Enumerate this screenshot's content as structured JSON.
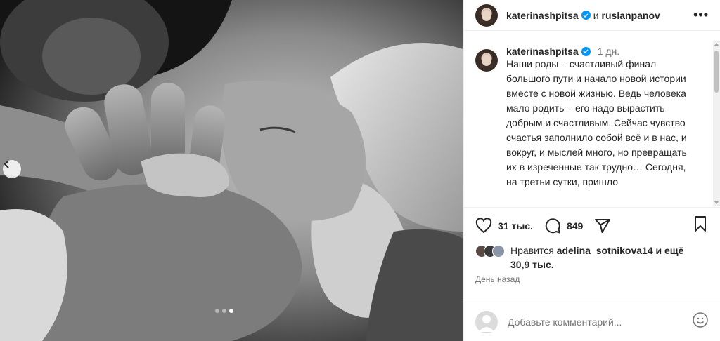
{
  "post": {
    "header": {
      "author": "katerinashpitsa",
      "and_text": "и",
      "coauthor": "ruslanpanov",
      "more_label": "•••"
    },
    "caption": {
      "username": "katerinashpitsa",
      "time": "1 дн.",
      "text": "Наши роды – счастливый финал большого пути и начало новой истории вместе с новой жизнью. Ведь человека мало родить – его надо вырастить добрым и счастливым. Сейчас чувство счастья заполнило собой всё и в нас, и вокруг, и мыслей много, но превращать их в изреченные так трудно… Сегодня, на третьи сутки, пришло"
    },
    "actions": {
      "like_count": "31 тыс.",
      "comment_count": "849"
    },
    "likes": {
      "prefix": "Нравится",
      "user": "adelina_sotnikova14",
      "conj": "и ещё",
      "rest": "30,9 тыс."
    },
    "date": "День назад",
    "comment_input": {
      "placeholder": "Добавьте комментарий..."
    },
    "carousel": {
      "slides": 3,
      "active_slide": 3
    }
  },
  "icons": {
    "like": "heart-icon",
    "comment": "comment-icon",
    "share": "paper-plane-icon",
    "save": "bookmark-icon",
    "emoji": "smiley-icon",
    "verified": "verified-badge-icon",
    "prev": "chevron-left-icon"
  },
  "colors": {
    "verified": "#0095f6",
    "secondary_text": "#737373"
  }
}
